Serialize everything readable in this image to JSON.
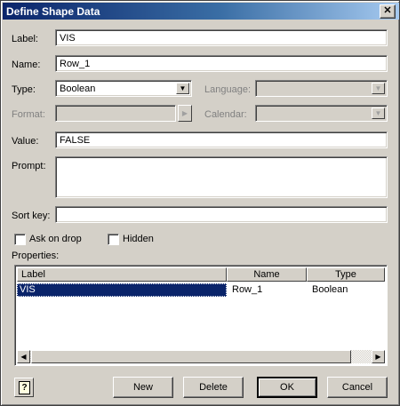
{
  "window": {
    "title": "Define Shape Data",
    "close_glyph": "✕"
  },
  "form": {
    "label": {
      "caption": "Label:",
      "value": "VIS"
    },
    "name": {
      "caption": "Name:",
      "value": "Row_1"
    },
    "type": {
      "caption": "Type:",
      "value": "Boolean"
    },
    "language": {
      "caption": "Language:",
      "value": ""
    },
    "format": {
      "caption": "Format:",
      "value": ""
    },
    "calendar": {
      "caption": "Calendar:",
      "value": ""
    },
    "value": {
      "caption": "Value:",
      "value": "FALSE"
    },
    "prompt": {
      "caption": "Prompt:",
      "value": ""
    },
    "sort_key": {
      "caption": "Sort key:",
      "value": ""
    },
    "ask_on_drop": {
      "caption": "Ask on drop",
      "checked": false
    },
    "hidden": {
      "caption": "Hidden",
      "checked": false
    }
  },
  "properties": {
    "caption": "Properties:",
    "columns": [
      "Label",
      "Name",
      "Type"
    ],
    "rows": [
      {
        "label": "VIS",
        "name": "Row_1",
        "type": "Boolean",
        "selected": true
      }
    ]
  },
  "buttons": {
    "help": "?",
    "new": "New",
    "delete": "Delete",
    "ok": "OK",
    "cancel": "Cancel"
  },
  "colors": {
    "selection": "#0a246a",
    "titlebar": "#0a246a",
    "face": "#d4d0c8"
  }
}
